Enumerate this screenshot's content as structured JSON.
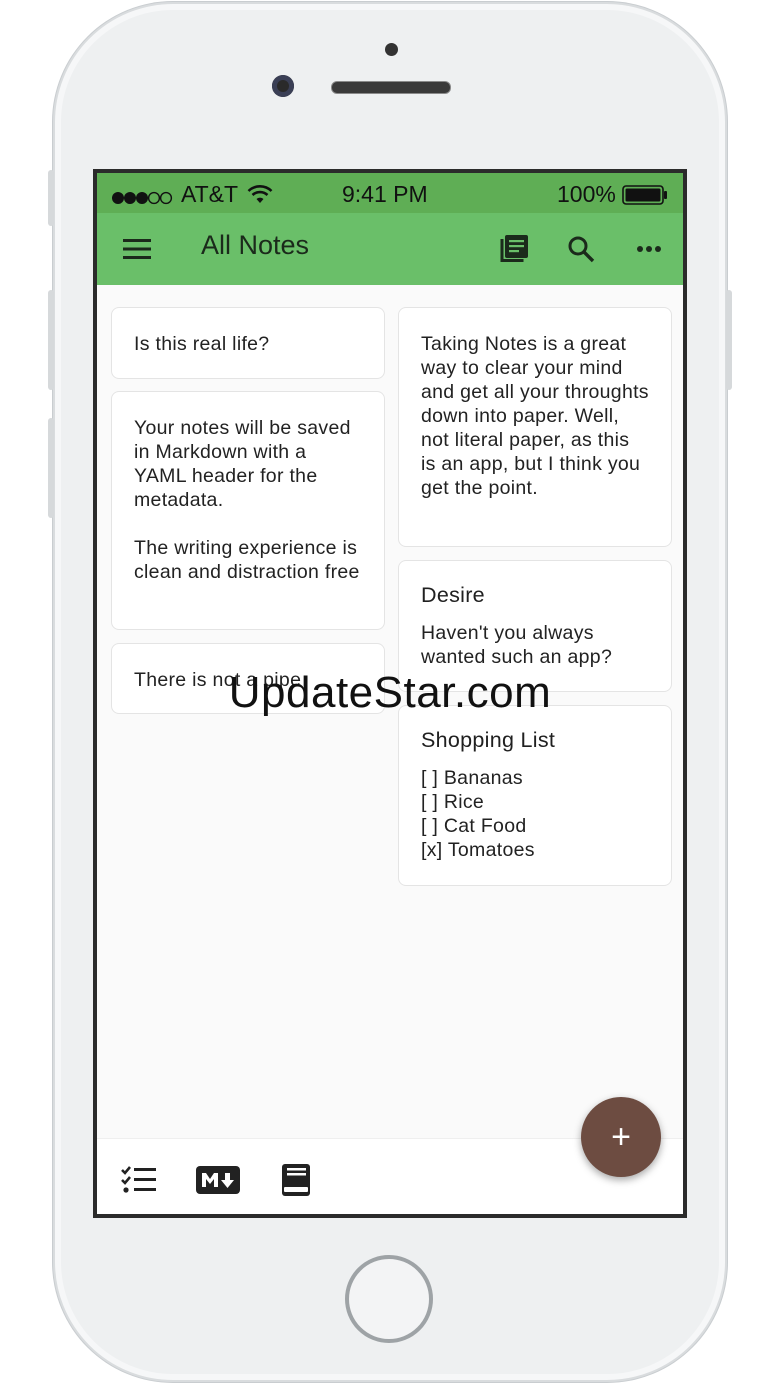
{
  "status_bar": {
    "carrier": "AT&T",
    "time": "9:41 PM",
    "battery": "100%"
  },
  "app_bar": {
    "title": "All Notes",
    "icons": [
      "menu-icon",
      "notebooks-icon",
      "search-icon",
      "more-icon"
    ]
  },
  "notes": [
    {
      "title": "",
      "body": "Is this real life?"
    },
    {
      "title": "",
      "body": "Your notes will be saved in Markdown with a YAML header for the metadata.\n\nThe writing experience is clean and distraction free"
    },
    {
      "title": "",
      "body": "There is not a pipe"
    },
    {
      "title": "",
      "body": "Taking Notes is a great way to clear your mind and get all your throughts down into paper. Well, not literal paper, as this is an app, but I think you get the point."
    },
    {
      "title": "Desire",
      "body": "Haven't you always wanted such an app?"
    },
    {
      "title": "Shopping List",
      "body": "[ ] Bananas\n[ ] Rice\n[ ] Cat Food\n[x] Tomatoes"
    }
  ],
  "bottom_bar": {
    "icons": [
      "checklist-icon",
      "markdown-icon",
      "notebook-icon"
    ]
  },
  "fab": {
    "label": "+"
  },
  "watermark": "UpdateStar.com",
  "colors": {
    "status_bar": "#5fae55",
    "app_bar": "#6abf69",
    "fab": "#6d4c41",
    "background": "#fafafa"
  }
}
